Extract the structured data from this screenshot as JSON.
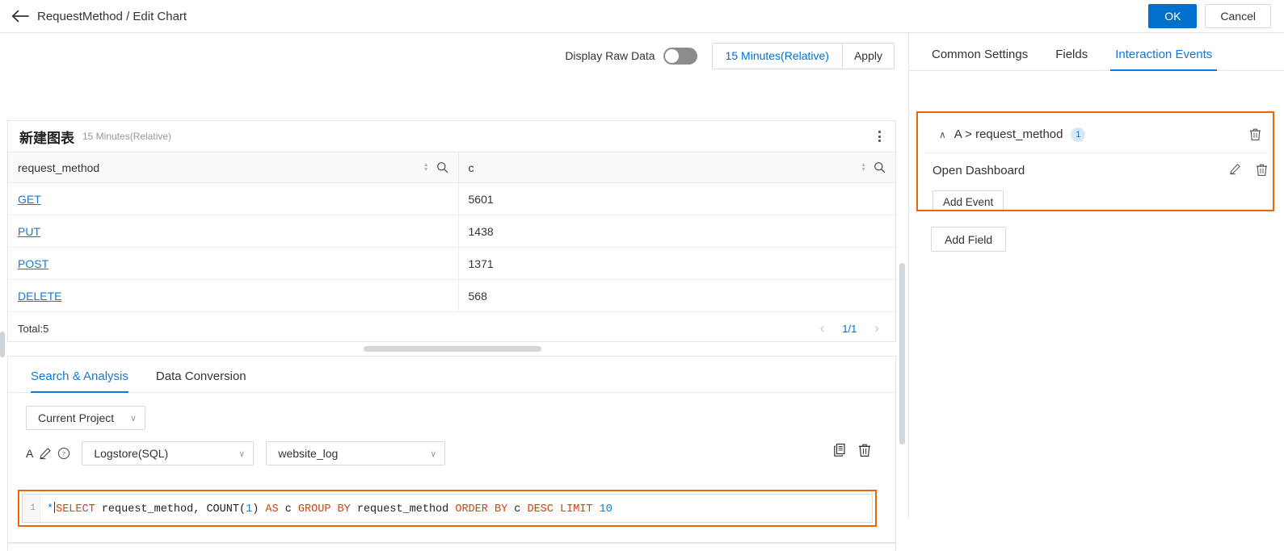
{
  "header": {
    "breadcrumb": "RequestMethod / Edit Chart",
    "back_icon": "arrow-left-icon",
    "ok_label": "OK",
    "cancel_label": "Cancel"
  },
  "toolbar": {
    "display_raw_data_label": "Display Raw Data",
    "toggle_state": "off",
    "time_range_label": "15 Minutes(Relative)",
    "apply_label": "Apply"
  },
  "chart": {
    "title": "新建图表",
    "subtitle": "15 Minutes(Relative)",
    "menu_icon": "more-vertical-icon",
    "table": {
      "columns": [
        "request_method",
        "c"
      ],
      "rows": [
        {
          "request_method": "GET",
          "c": "5601"
        },
        {
          "request_method": "PUT",
          "c": "1438"
        },
        {
          "request_method": "POST",
          "c": "1371"
        },
        {
          "request_method": "DELETE",
          "c": "568"
        }
      ],
      "total_label": "Total:5",
      "page_label": "1/1",
      "prev_icon": "chevron-left-icon",
      "next_icon": "chevron-right-icon",
      "sort_icon": "sort-icon",
      "search_icon": "search-icon"
    }
  },
  "query_panel": {
    "tabs": [
      {
        "label": "Search & Analysis",
        "active": true
      },
      {
        "label": "Data Conversion",
        "active": false
      }
    ],
    "project_select": "Current Project",
    "query_label": "A",
    "edit_icon": "pencil-icon",
    "help_icon": "question-circle-icon",
    "source_type": "Logstore(SQL)",
    "logstore": "website_log",
    "copy_icon": "copy-icon",
    "delete_icon": "trash-icon",
    "sql": {
      "line_number": "1",
      "tokens": [
        {
          "t": "*",
          "c": "star"
        },
        {
          "t": "caret",
          "c": "caret"
        },
        {
          "t": "SELECT",
          "c": "kw"
        },
        {
          "t": " request_method, ",
          "c": "pl"
        },
        {
          "t": "COUNT",
          "c": "pl"
        },
        {
          "t": "(",
          "c": "pl"
        },
        {
          "t": "1",
          "c": "num"
        },
        {
          "t": ")",
          "c": "pl"
        },
        {
          "t": " ",
          "c": "pl"
        },
        {
          "t": "AS",
          "c": "kw"
        },
        {
          "t": " c ",
          "c": "pl"
        },
        {
          "t": "GROUP BY",
          "c": "kw"
        },
        {
          "t": " request_method ",
          "c": "pl"
        },
        {
          "t": "ORDER BY",
          "c": "kw"
        },
        {
          "t": " c ",
          "c": "pl"
        },
        {
          "t": "DESC",
          "c": "kw"
        },
        {
          "t": " ",
          "c": "pl"
        },
        {
          "t": "LIMIT",
          "c": "kw"
        },
        {
          "t": " ",
          "c": "pl"
        },
        {
          "t": "10",
          "c": "num"
        }
      ],
      "plain": "* SELECT request_method, COUNT(1) AS c GROUP BY request_method ORDER BY c DESC LIMIT 10"
    }
  },
  "right_panel": {
    "tabs": [
      {
        "label": "Common Settings",
        "active": false
      },
      {
        "label": "Fields",
        "active": false
      },
      {
        "label": "Interaction Events",
        "active": true
      }
    ],
    "event_group": {
      "collapse_icon": "chevron-up-icon",
      "title": "A > request_method",
      "count": "1",
      "delete_icon": "trash-icon",
      "events": [
        {
          "label": "Open Dashboard",
          "edit_icon": "pencil-icon",
          "delete_icon": "trash-icon"
        }
      ],
      "add_event_label": "Add Event"
    },
    "add_field_label": "Add Field"
  },
  "colors": {
    "accent": "#1677d2",
    "primary_button": "#0070cc",
    "highlight": "#ec6608",
    "link": "#1677d2",
    "badge_bg": "#d6e8f8"
  }
}
